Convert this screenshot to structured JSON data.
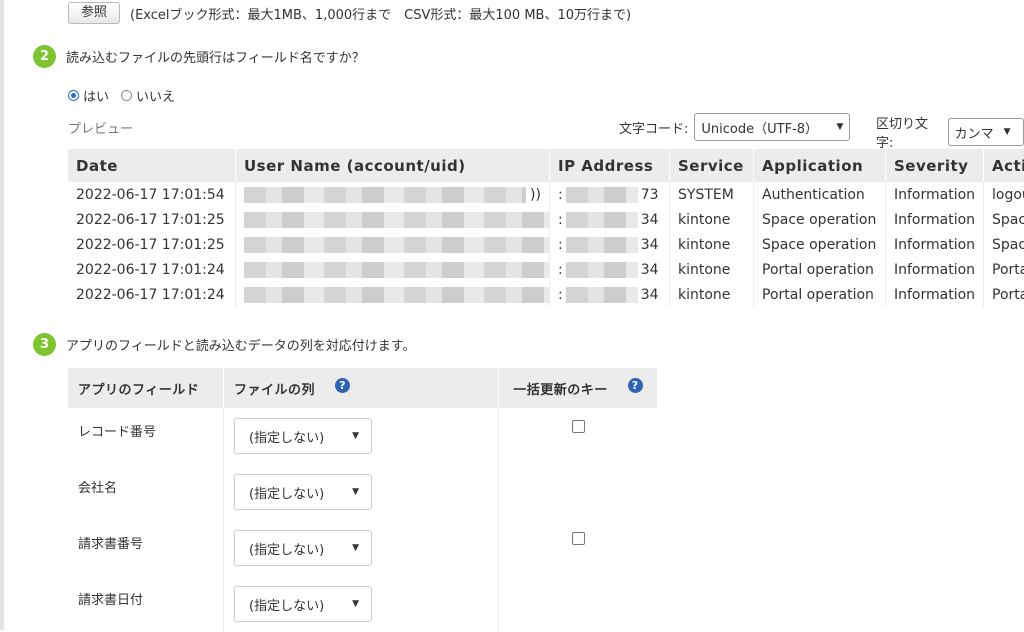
{
  "upload": {
    "browse_label": "参照",
    "limits_note": "(Excelブック形式：最大1MB、1,000行まで　CSV形式：最大100 MB、10万行まで)"
  },
  "step2": {
    "number": "2",
    "text": "読み込むファイルの先頭行はフィールド名ですか？",
    "options": [
      {
        "label": "はい",
        "selected": true
      },
      {
        "label": "いいえ",
        "selected": false
      }
    ]
  },
  "preview": {
    "label": "プレビュー",
    "encoding_label": "文字コード:",
    "encoding_value": "Unicode（UTF-8）",
    "delimiter_label": "区切り文字:",
    "delimiter_value": "カンマ",
    "columns": [
      "Date",
      "User Name (account/uid)",
      "IP Address",
      "Service",
      "Application",
      "Severity",
      "Acti"
    ],
    "rows": [
      {
        "date": "2022-06-17 17:01:54",
        "user_tail": "))",
        "ip_head": ":",
        "ip_tail": "73",
        "service": "SYSTEM",
        "application": "Authentication",
        "severity": "Information",
        "action": "logou"
      },
      {
        "date": "2022-06-17 17:01:25",
        "user_tail": "",
        "ip_head": ":",
        "ip_tail": "34",
        "service": "kintone",
        "application": "Space operation",
        "severity": "Information",
        "action": "Spac"
      },
      {
        "date": "2022-06-17 17:01:25",
        "user_tail": "",
        "ip_head": ":",
        "ip_tail": "34",
        "service": "kintone",
        "application": "Space operation",
        "severity": "Information",
        "action": "Spac"
      },
      {
        "date": "2022-06-17 17:01:24",
        "user_tail": "",
        "ip_head": ":",
        "ip_tail": "34",
        "service": "kintone",
        "application": "Portal operation",
        "severity": "Information",
        "action": "Porta"
      },
      {
        "date": "2022-06-17 17:01:24",
        "user_tail": "",
        "ip_head": ":",
        "ip_tail": "34",
        "service": "kintone",
        "application": "Portal operation",
        "severity": "Information",
        "action": "Porta"
      }
    ]
  },
  "step3": {
    "number": "3",
    "text": "アプリのフィールドと読み込むデータの列を対応付けます。"
  },
  "mapping": {
    "headers": {
      "field": "アプリのフィールド",
      "file_column": "ファイルの列",
      "update_key": "一括更新のキー",
      "help_glyph": "?"
    },
    "rows": [
      {
        "field": "レコード番号",
        "select": "(指定しない)",
        "has_key_checkbox": true
      },
      {
        "field": "会社名",
        "select": "(指定しない)",
        "has_key_checkbox": false
      },
      {
        "field": "請求書番号",
        "select": "(指定しない)",
        "has_key_checkbox": true
      },
      {
        "field": "請求書日付",
        "select": "(指定しない)",
        "has_key_checkbox": false
      }
    ]
  },
  "colors": {
    "step_badge": "#7dc52e",
    "help_icon": "#2e63b8",
    "radio_selected": "#2b6bd6",
    "table_header_bg": "#ececec"
  }
}
